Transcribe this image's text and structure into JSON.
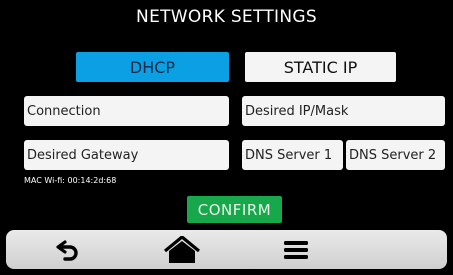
{
  "header": {
    "title": "NETWORK SETTINGS"
  },
  "mode": {
    "dhcp_label": "DHCP",
    "static_label": "STATIC IP",
    "selected": "DHCP"
  },
  "fields": {
    "connection": "Connection",
    "desired_ip_mask": "Desired IP/Mask",
    "desired_gateway": "Desired Gateway",
    "dns_server_1": "DNS Server 1",
    "dns_server_2": "DNS Server 2"
  },
  "mac_address": "MAC Wi-fi: 00:14:2d:68",
  "actions": {
    "confirm_label": "CONFIRM"
  },
  "navbar": {
    "icons": [
      "back-arrow-icon",
      "home-icon",
      "menu-icon"
    ]
  },
  "colors": {
    "dhcp_selected": "#0aa0e3",
    "button_default": "#f4f4f4",
    "confirm": "#16a84a",
    "background": "#000000"
  }
}
